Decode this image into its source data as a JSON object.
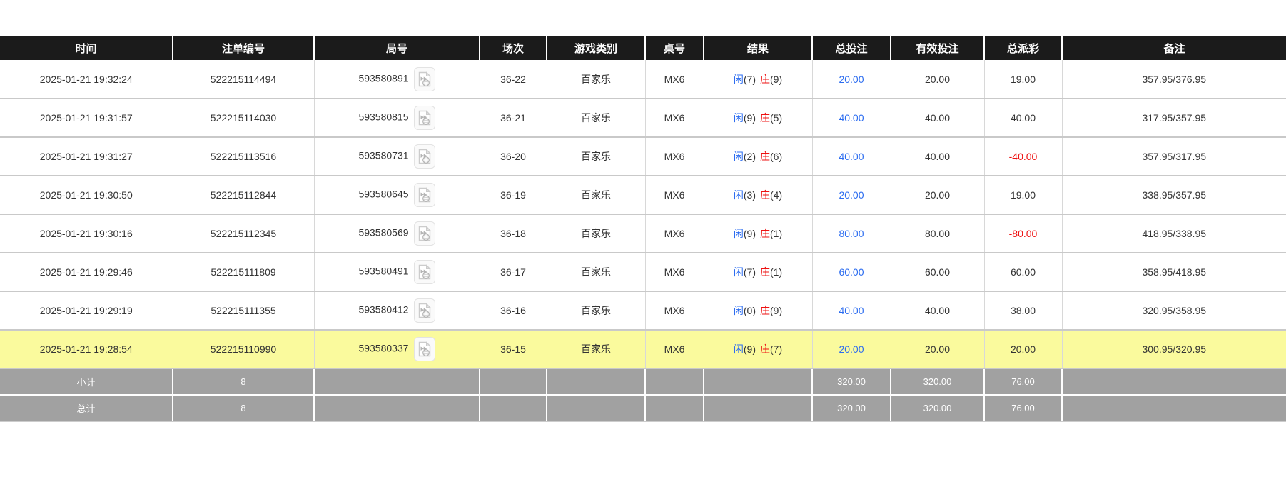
{
  "table": {
    "header": {
      "columns": [
        "时间",
        "注单编号",
        "局号",
        "场次",
        "游戏类别",
        "桌号",
        "结果",
        "总投注",
        "有效投注",
        "总派彩",
        "备注"
      ]
    },
    "result_labels": {
      "player": "闲",
      "banker": "庄"
    },
    "rows": [
      {
        "time": "2025-01-21 19:32:24",
        "bet_id": "522215114494",
        "round_id": "593580891",
        "session": "36-22",
        "game_type": "百家乐",
        "table_no": "MX6",
        "player_score": "(7)",
        "banker_score": "(9)",
        "total_bet": "20.00",
        "valid_bet": "20.00",
        "payout": "19.00",
        "payout_negative": false,
        "remark": "357.95/376.95",
        "highlighted": false
      },
      {
        "time": "2025-01-21 19:31:57",
        "bet_id": "522215114030",
        "round_id": "593580815",
        "session": "36-21",
        "game_type": "百家乐",
        "table_no": "MX6",
        "player_score": "(9)",
        "banker_score": "(5)",
        "total_bet": "40.00",
        "valid_bet": "40.00",
        "payout": "40.00",
        "payout_negative": false,
        "remark": "317.95/357.95",
        "highlighted": false
      },
      {
        "time": "2025-01-21 19:31:27",
        "bet_id": "522215113516",
        "round_id": "593580731",
        "session": "36-20",
        "game_type": "百家乐",
        "table_no": "MX6",
        "player_score": "(2)",
        "banker_score": "(6)",
        "total_bet": "40.00",
        "valid_bet": "40.00",
        "payout": "-40.00",
        "payout_negative": true,
        "remark": "357.95/317.95",
        "highlighted": false
      },
      {
        "time": "2025-01-21 19:30:50",
        "bet_id": "522215112844",
        "round_id": "593580645",
        "session": "36-19",
        "game_type": "百家乐",
        "table_no": "MX6",
        "player_score": "(3)",
        "banker_score": "(4)",
        "total_bet": "20.00",
        "valid_bet": "20.00",
        "payout": "19.00",
        "payout_negative": false,
        "remark": "338.95/357.95",
        "highlighted": false
      },
      {
        "time": "2025-01-21 19:30:16",
        "bet_id": "522215112345",
        "round_id": "593580569",
        "session": "36-18",
        "game_type": "百家乐",
        "table_no": "MX6",
        "player_score": "(9)",
        "banker_score": "(1)",
        "total_bet": "80.00",
        "valid_bet": "80.00",
        "payout": "-80.00",
        "payout_negative": true,
        "remark": "418.95/338.95",
        "highlighted": false
      },
      {
        "time": "2025-01-21 19:29:46",
        "bet_id": "522215111809",
        "round_id": "593580491",
        "session": "36-17",
        "game_type": "百家乐",
        "table_no": "MX6",
        "player_score": "(7)",
        "banker_score": "(1)",
        "total_bet": "60.00",
        "valid_bet": "60.00",
        "payout": "60.00",
        "payout_negative": false,
        "remark": "358.95/418.95",
        "highlighted": false
      },
      {
        "time": "2025-01-21 19:29:19",
        "bet_id": "522215111355",
        "round_id": "593580412",
        "session": "36-16",
        "game_type": "百家乐",
        "table_no": "MX6",
        "player_score": "(0)",
        "banker_score": "(9)",
        "total_bet": "40.00",
        "valid_bet": "40.00",
        "payout": "38.00",
        "payout_negative": false,
        "remark": "320.95/358.95",
        "highlighted": false
      },
      {
        "time": "2025-01-21 19:28:54",
        "bet_id": "522215110990",
        "round_id": "593580337",
        "session": "36-15",
        "game_type": "百家乐",
        "table_no": "MX6",
        "player_score": "(9)",
        "banker_score": "(7)",
        "total_bet": "20.00",
        "valid_bet": "20.00",
        "payout": "20.00",
        "payout_negative": false,
        "remark": "300.95/320.95",
        "highlighted": true
      }
    ],
    "footer_rows": [
      {
        "label": "小计",
        "count": "8",
        "total_bet": "320.00",
        "valid_bet": "320.00",
        "payout": "76.00"
      },
      {
        "label": "总计",
        "count": "8",
        "total_bet": "320.00",
        "valid_bet": "320.00",
        "payout": "76.00"
      }
    ]
  },
  "icons": {
    "video_icon": "video-replay-icon"
  },
  "colors": {
    "header_bg": "#1b1b1b",
    "header_text": "#ffffff",
    "row_highlight": "#fafa9d",
    "footer_bg": "#a1a1a1",
    "footer_text": "#ffffff",
    "bet_amount_blue": "#2b6cf0",
    "player_blue": "#2b6cf0",
    "banker_red": "#ee1111",
    "negative_payout_red": "#ee1111"
  }
}
